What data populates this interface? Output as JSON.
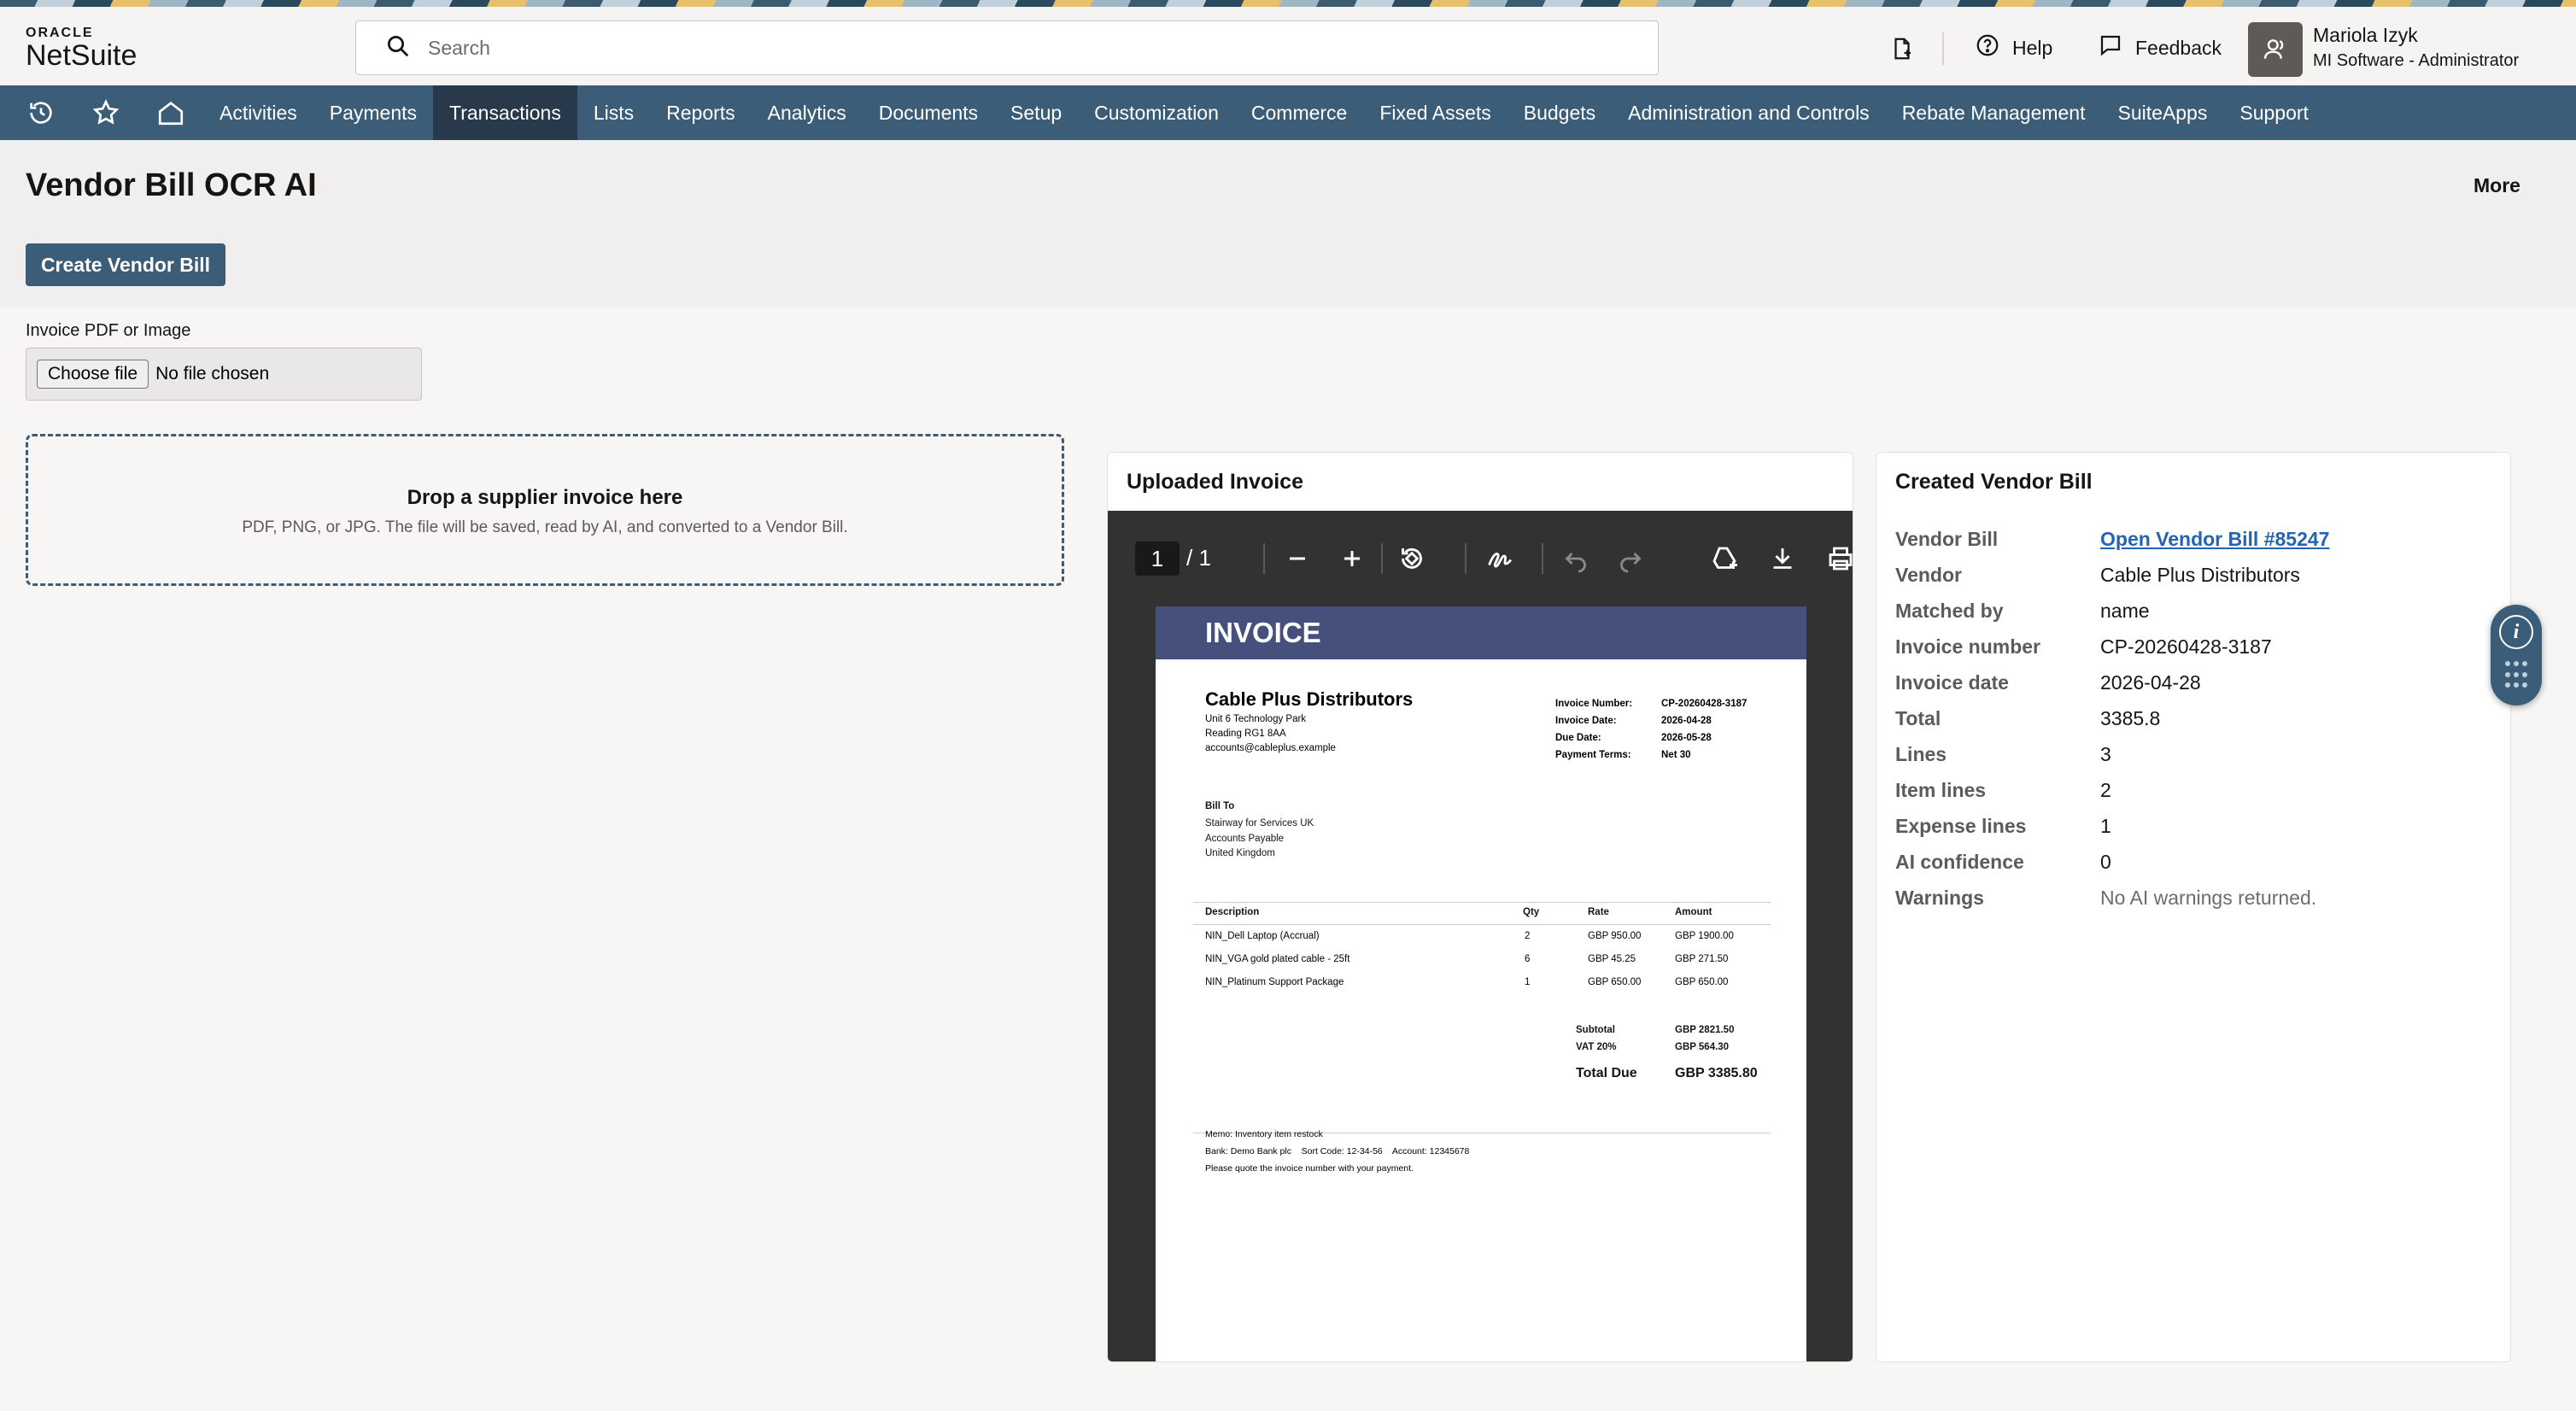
{
  "brand": {
    "oracle": "ORACLE",
    "netsuite": "NetSuite"
  },
  "header": {
    "search_placeholder": "Search",
    "help_label": "Help",
    "feedback_label": "Feedback",
    "user_name": "Mariola Izyk",
    "user_role": "MI Software - Administrator"
  },
  "nav": {
    "items": [
      "Activities",
      "Payments",
      "Transactions",
      "Lists",
      "Reports",
      "Analytics",
      "Documents",
      "Setup",
      "Customization",
      "Commerce",
      "Fixed Assets",
      "Budgets",
      "Administration and Controls",
      "Rebate Management",
      "SuiteApps",
      "Support"
    ],
    "active": "Transactions"
  },
  "page": {
    "title": "Vendor Bill OCR AI",
    "more_label": "More",
    "create_button": "Create Vendor Bill"
  },
  "upload": {
    "label": "Invoice PDF or Image",
    "choose_button": "Choose file",
    "no_file": "No file chosen",
    "drop_title": "Drop a supplier invoice here",
    "drop_subtitle": "PDF, PNG, or JPG. The file will be saved, read by AI, and converted to a Vendor Bill."
  },
  "viewer": {
    "panel_title": "Uploaded Invoice",
    "page_current": "1",
    "page_total": "/ 1",
    "icons": [
      "minus-icon",
      "plus-icon",
      "rotate-icon",
      "draw-icon",
      "undo-icon",
      "redo-icon",
      "save-drive-icon",
      "download-icon",
      "print-icon"
    ]
  },
  "invoice": {
    "heading": "INVOICE",
    "vendor_name": "Cable Plus Distributors",
    "vendor_addr": [
      "Unit 6 Technology Park",
      "Reading RG1 8AA",
      "accounts@cableplus.example"
    ],
    "meta": [
      {
        "k": "Invoice Number:",
        "v": "CP-20260428-3187"
      },
      {
        "k": "Invoice Date:",
        "v": "2026-04-28"
      },
      {
        "k": "Due Date:",
        "v": "2026-05-28"
      },
      {
        "k": "Payment Terms:",
        "v": "Net 30"
      }
    ],
    "bill_to_label": "Bill To",
    "bill_to": [
      "Stairway for Services UK",
      "Accounts Payable",
      "United Kingdom"
    ],
    "columns": [
      "Description",
      "Qty",
      "Rate",
      "Amount"
    ],
    "lines": [
      {
        "desc": "NIN_Dell Laptop (Accrual)",
        "qty": "2",
        "rate": "GBP 950.00",
        "amount": "GBP 1900.00"
      },
      {
        "desc": "NIN_VGA gold plated cable - 25ft",
        "qty": "6",
        "rate": "GBP 45.25",
        "amount": "GBP 271.50"
      },
      {
        "desc": "NIN_Platinum Support Package",
        "qty": "1",
        "rate": "GBP 650.00",
        "amount": "GBP 650.00"
      }
    ],
    "subtotal_label": "Subtotal",
    "subtotal": "GBP 2821.50",
    "vat_label": "VAT 20%",
    "vat": "GBP 564.30",
    "total_label": "Total Due",
    "total": "GBP 3385.80",
    "memo": "Memo: Inventory item restock",
    "bank": "Bank: Demo Bank plc    Sort Code: 12-34-56    Account: 12345678",
    "note": "Please quote the invoice number with your payment."
  },
  "bill": {
    "panel_title": "Created Vendor Bill",
    "fields": [
      {
        "key": "Vendor Bill",
        "value": "Open Vendor Bill #85247",
        "link": true
      },
      {
        "key": "Vendor",
        "value": "Cable Plus Distributors"
      },
      {
        "key": "Matched by",
        "value": "name"
      },
      {
        "key": "Invoice number",
        "value": "CP-20260428-3187"
      },
      {
        "key": "Invoice date",
        "value": "2026-04-28"
      },
      {
        "key": "Total",
        "value": "3385.8"
      },
      {
        "key": "Lines",
        "value": "3"
      },
      {
        "key": "Item lines",
        "value": "2"
      },
      {
        "key": "Expense lines",
        "value": "1"
      },
      {
        "key": "AI confidence",
        "value": "0"
      },
      {
        "key": "Warnings",
        "value": "No AI warnings returned.",
        "muted": true
      }
    ]
  },
  "colors": {
    "nav": "#3b5d77",
    "nav_active": "#27394a",
    "invoice_header": "#46507c",
    "link": "#2563b3"
  }
}
